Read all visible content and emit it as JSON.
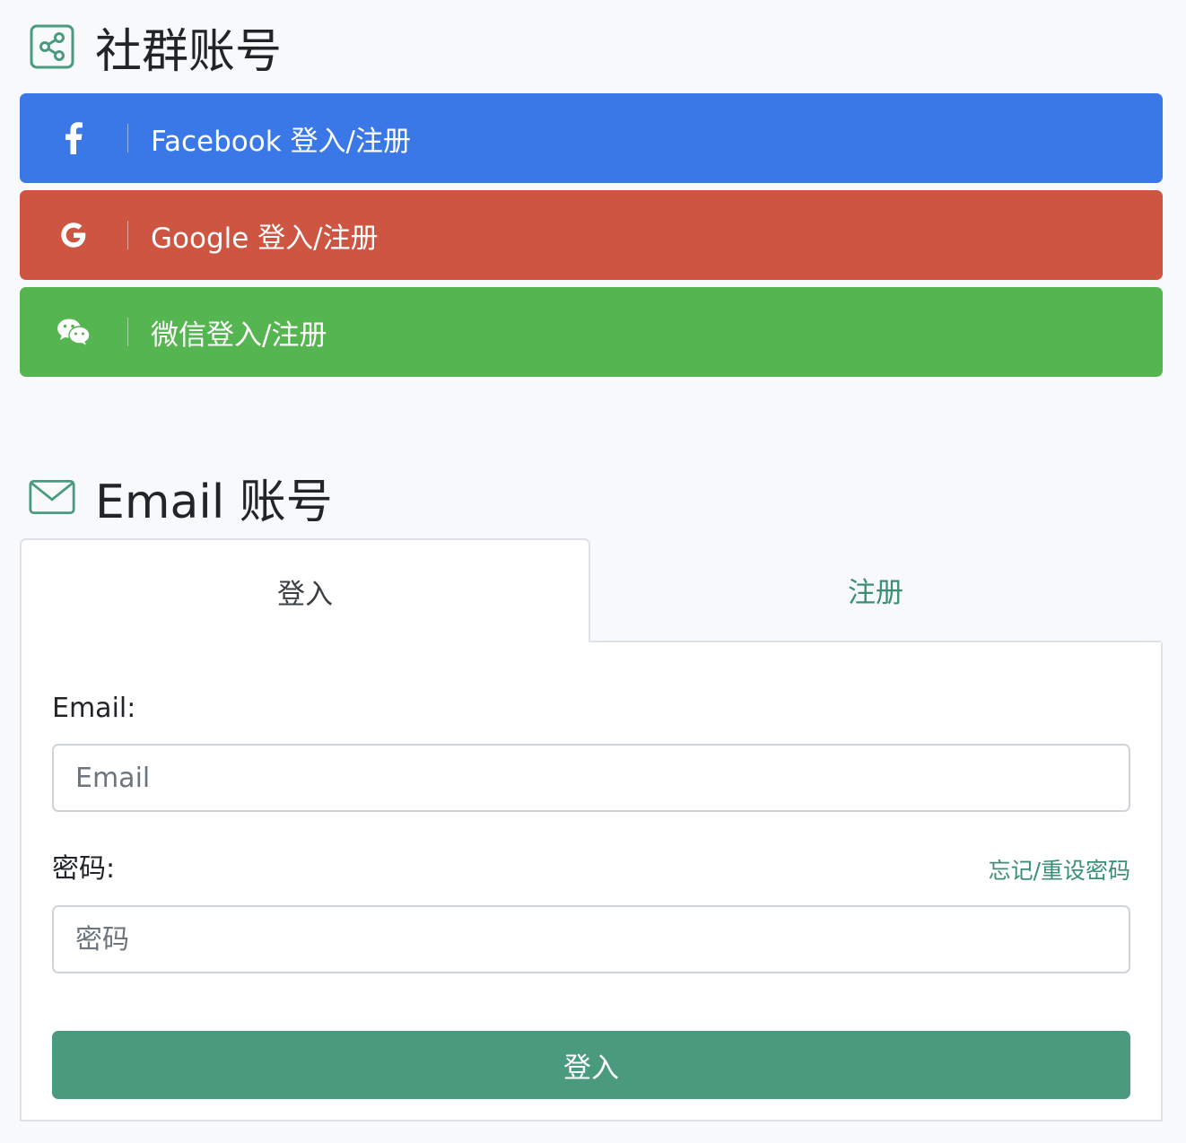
{
  "social": {
    "title": "社群账号",
    "icon": "share-icon",
    "buttons": [
      {
        "label": "Facebook 登入/注册",
        "icon": "facebook-icon",
        "color": "#3b78e7"
      },
      {
        "label": "Google 登入/注册",
        "icon": "google-icon",
        "color": "#cd5542"
      },
      {
        "label": "微信登入/注册",
        "icon": "wechat-icon",
        "color": "#55b550"
      }
    ]
  },
  "email": {
    "title": "Email 账号",
    "icon": "envelope-icon",
    "tabs": [
      {
        "label": "登入",
        "active": true
      },
      {
        "label": "注册",
        "active": false
      }
    ],
    "form": {
      "email_label": "Email:",
      "email_placeholder": "Email",
      "password_label": "密码:",
      "forgot_link": "忘记/重设密码",
      "password_placeholder": "密码",
      "submit_label": "登入"
    }
  },
  "colors": {
    "accent": "#4a9a7e",
    "background": "#f8f9fa"
  }
}
